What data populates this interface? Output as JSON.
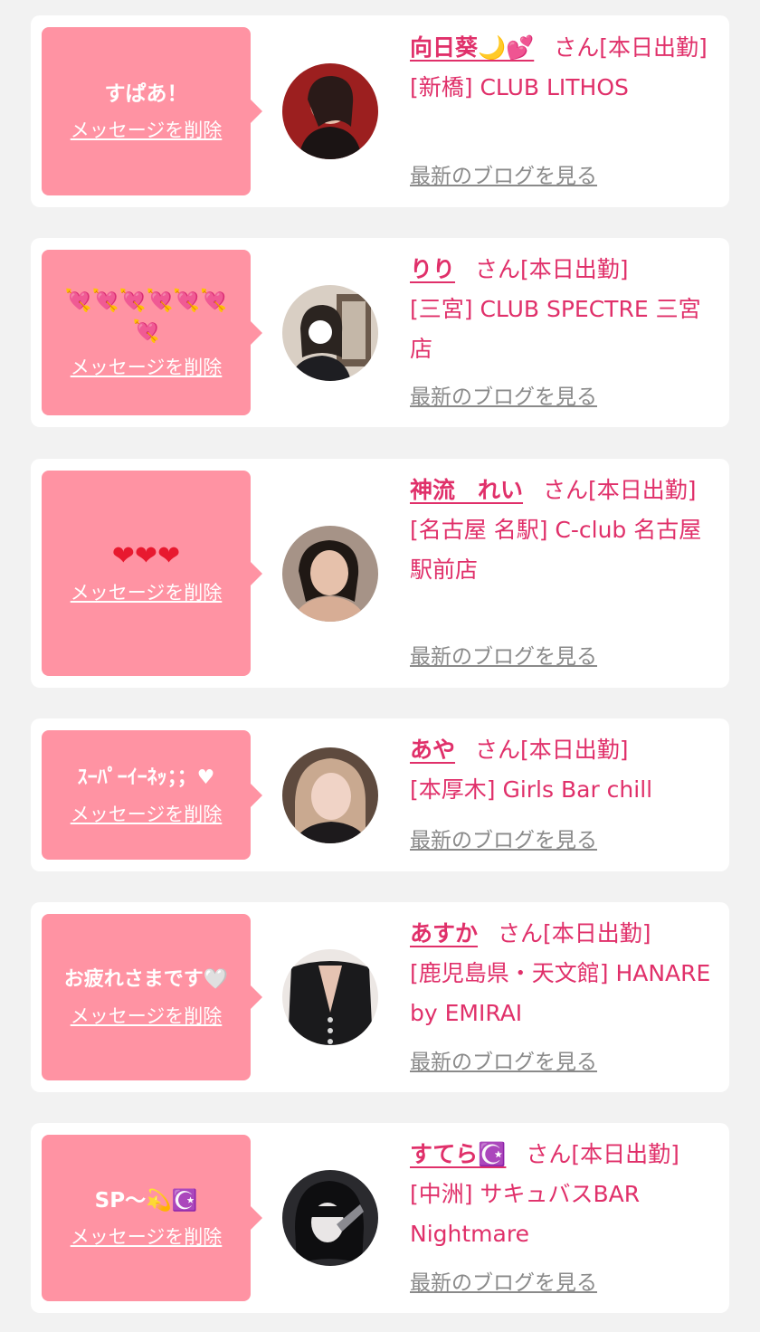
{
  "suffix": "さん[本日出勤]",
  "blog_label": "最新のブログを見る",
  "delete_label": "メッセージを削除",
  "entries": [
    {
      "name": "向日葵🌙💕",
      "shop": "[新橋] CLUB LITHOS",
      "message": "すぱあ！"
    },
    {
      "name": "りり",
      "shop": "[三宮] CLUB SPECTRE 三宮店",
      "message": "💘💘💘💘💘💘💘"
    },
    {
      "name": "神流　れい",
      "shop": "[名古屋 名駅] C-club 名古屋駅前店",
      "message": "❤❤❤"
    },
    {
      "name": "あや",
      "shop": "[本厚木] Girls Bar chill",
      "message": "ｽｰﾊﾟｰｲｰﾈｯ；；♥"
    },
    {
      "name": "あすか",
      "shop": "[鹿児島県・天文館] HANARE by EMIRAI",
      "message": "お疲れさまです🤍"
    },
    {
      "name": "すてら☪️",
      "shop": "[中洲] サキュバスBAR Nightmare",
      "message": "SP〜💫☪️"
    }
  ],
  "colors": {
    "background": "#f2f2f2",
    "card": "#ffffff",
    "bubble": "#ff93a3",
    "accent_text": "#e0306a",
    "link_gray": "#8a8a8a"
  },
  "icons": [
    "avatar-photo",
    "heart-emoji",
    "moon-emoji",
    "star-crescent-emoji",
    "dizzy-emoji",
    "white-heart-emoji"
  ]
}
